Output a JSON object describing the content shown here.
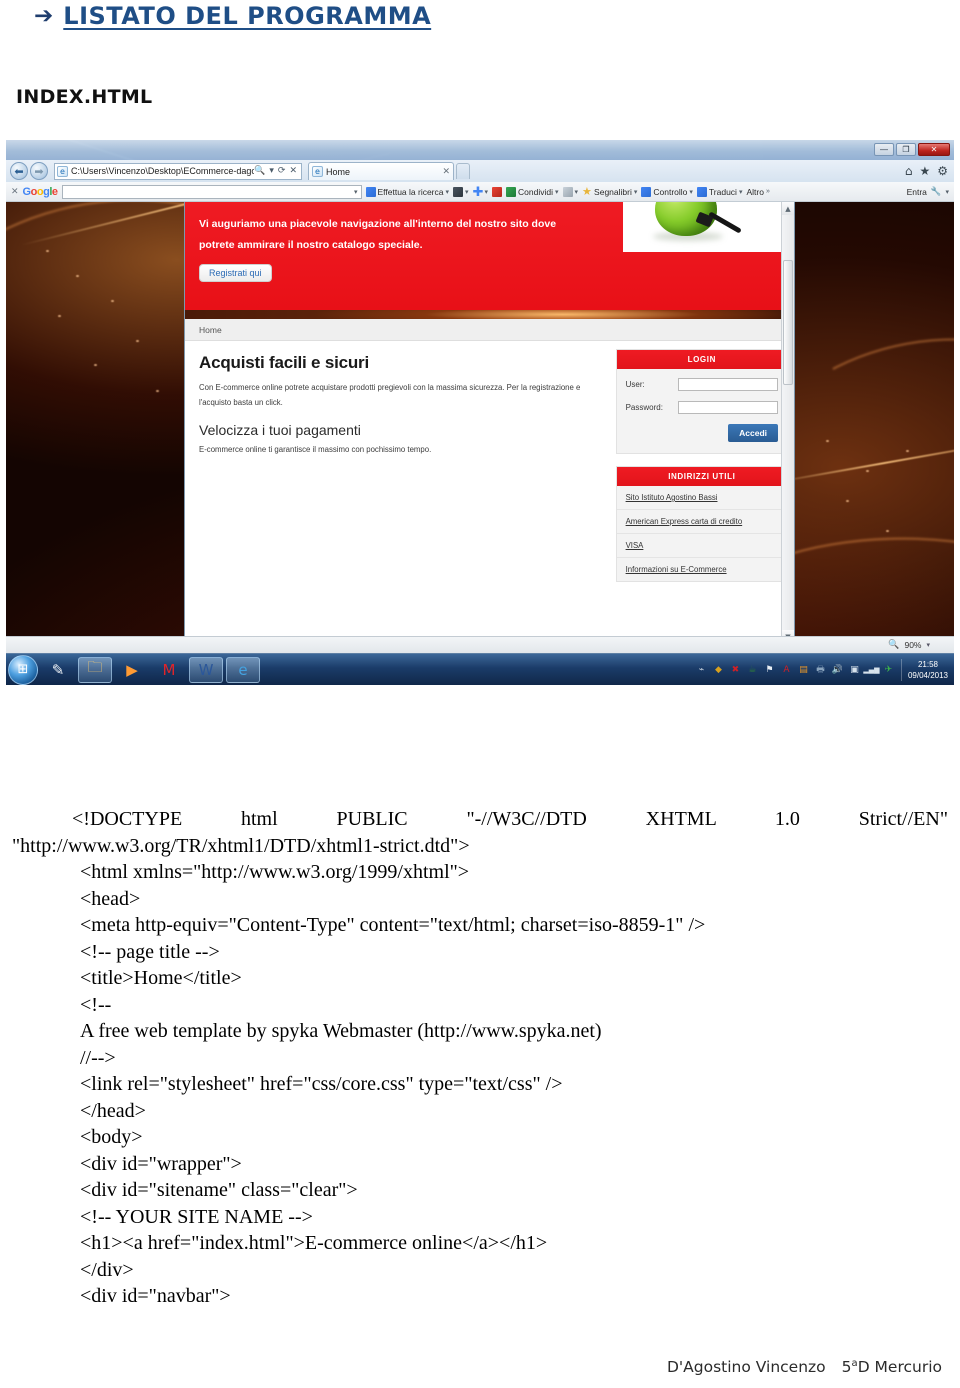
{
  "document": {
    "arrow": "➔",
    "heading": "LISTATO DEL PROGRAMMA",
    "subheading": "INDEX.HTML"
  },
  "screenshot": {
    "browser": {
      "window_controls": {
        "minimize": "—",
        "maximize": "❐",
        "close": "✕"
      },
      "back_arrow": "⬅",
      "forward_arrow": "➡",
      "address": "C:\\Users\\Vincenzo\\Desktop\\ECommerce-dago\\EC(",
      "address_icons": {
        "search": "🔍",
        "dropdown": "▾",
        "refresh": "⟳",
        "stop": "✕"
      },
      "tab_title": "Home",
      "tab_close": "✕",
      "tools": {
        "home": "⌂",
        "favorites": "★",
        "settings": "⚙"
      }
    },
    "google_toolbar": {
      "close": "✕",
      "logo": {
        "g1": "G",
        "o1": "o",
        "o2": "o",
        "g2": "g",
        "l": "l",
        "e": "e"
      },
      "search_placeholder": "",
      "search_caret": "▾",
      "items": [
        {
          "label": "Effettua la ricerca",
          "caret": "▾",
          "icon": "google-search-icon"
        },
        {
          "label": "",
          "caret": "▾",
          "icon": "bookmark-box-icon"
        },
        {
          "label": "",
          "caret": "▾",
          "icon": "plus-icon"
        },
        {
          "label": "",
          "caret": "",
          "icon": "youtube-icon"
        },
        {
          "label": "Condividi",
          "caret": "▾",
          "icon": "share-icon"
        },
        {
          "label": "",
          "caret": "▾",
          "icon": "popup-blocker-icon"
        },
        {
          "label": "Segnalibri",
          "caret": "▾",
          "icon": "star-icon"
        },
        {
          "label": "Controllo",
          "caret": "▾",
          "icon": "spellcheck-icon"
        },
        {
          "label": "Traduci",
          "caret": "▾",
          "icon": "translate-icon"
        },
        {
          "label": "Altro",
          "caret": "»",
          "icon": "more-icon"
        }
      ],
      "signin_label": "Entra",
      "signin_caret": "▾",
      "wrench_icon": "🔧"
    },
    "webpage": {
      "hero": {
        "line1": "Vi auguriamo una piacevole navigazione all'interno del nostro sito dove",
        "line2": "potrete ammirare il nostro catalogo speciale.",
        "button": "Registrati qui",
        "image_alt": "green-apple-with-usb-cable"
      },
      "breadcrumb": "Home",
      "main": {
        "heading1": "Acquisti facili e sicuri",
        "paragraph1": "Con E-commerce online potrete acquistare prodotti pregievoli con la massima sicurezza. Per la registrazione e l'acquisto basta un click.",
        "heading2": "Velocizza i tuoi pagamenti",
        "paragraph2": "E-commerce online ti garantisce il massimo con pochissimo tempo."
      },
      "login_widget": {
        "title": "LOGIN",
        "user_label": "User:",
        "user_value": "",
        "password_label": "Password:",
        "password_value": "",
        "submit_label": "Accedi"
      },
      "links_widget": {
        "title": "INDIRIZZI UTILI",
        "links": [
          "Sito Istituto Agostino Bassi",
          "American Express carta di credito",
          "VISA",
          "Informazioni su E-Commerce"
        ]
      },
      "scrollbar": {
        "up": "▲",
        "down": "▼"
      }
    },
    "status_bar": {
      "zoom_icon": "🔍",
      "zoom_level": "90%",
      "zoom_caret": "▾"
    },
    "taskbar": {
      "start_icon": "⊞",
      "pinned": [
        {
          "name": "paint-icon",
          "glyph": "✎"
        },
        {
          "name": "explorer-folder-icon",
          "glyph": "🗀"
        },
        {
          "name": "media-player-icon",
          "glyph": "▶"
        },
        {
          "name": "mcafee-icon",
          "glyph": "M"
        },
        {
          "name": "word-icon",
          "glyph": "W"
        },
        {
          "name": "internet-explorer-icon",
          "glyph": "e"
        }
      ],
      "tray": [
        {
          "name": "show-hidden-icon",
          "glyph": "⌁",
          "color": "#cfd8e0"
        },
        {
          "name": "security-shield-icon",
          "glyph": "◆",
          "color": "#d8a11e"
        },
        {
          "name": "antivirus-icon",
          "glyph": "✖",
          "color": "#cf2026"
        },
        {
          "name": "java-icon",
          "glyph": "☕",
          "color": "#2f7d3a"
        },
        {
          "name": "flag-action-center-icon",
          "glyph": "⚑",
          "color": "#e8eef4"
        },
        {
          "name": "adobe-reader-icon",
          "glyph": "A",
          "color": "#cf2026"
        },
        {
          "name": "updater-icon",
          "glyph": "▤",
          "color": "#e8972a"
        },
        {
          "name": "printer-icon",
          "glyph": "🖶",
          "color": "#8aa4bd"
        },
        {
          "name": "volume-icon",
          "glyph": "🔊",
          "color": "#e8eef4"
        },
        {
          "name": "device-icon",
          "glyph": "▣",
          "color": "#d7e2ec"
        },
        {
          "name": "network-signal-icon",
          "glyph": "▂▄▆",
          "color": "#d7e2ec"
        },
        {
          "name": "messenger-icon",
          "glyph": "✈",
          "color": "#3cb44a"
        }
      ],
      "time": "21:58",
      "date": "09/04/2013"
    }
  },
  "code": {
    "line1": "<!DOCTYPE html PUBLIC \"-//W3C//DTD XHTML 1.0 Strict//EN\"",
    "line2": "\"http://www.w3.org/TR/xhtml1/DTD/xhtml1-strict.dtd\">",
    "line3": "<html xmlns=\"http://www.w3.org/1999/xhtml\">",
    "line4": "<head>",
    "line5": "<meta http-equiv=\"Content-Type\" content=\"text/html; charset=iso-8859-1\" />",
    "line6": "<!-- page title -->",
    "line7": "<title>Home</title>",
    "line8": "<!--",
    "line9": "A free web template by spyka Webmaster (http://www.spyka.net)",
    "line10": "//-->",
    "line11": "<link rel=\"stylesheet\" href=\"css/core.css\" type=\"text/css\" />",
    "line12": "</head>",
    "line13": "<body>",
    "line14": "<div id=\"wrapper\">",
    "line15": "<div id=\"sitename\" class=\"clear\">",
    "line16": "<!-- YOUR SITE NAME -->",
    "line17": "<h1><a href=\"index.html\">E-commerce online</a></h1>",
    "line18": "</div>",
    "line19": "<div id=\"navbar\">"
  },
  "footer": {
    "author": "D'Agostino Vincenzo",
    "class_number": "5",
    "class_sup": "a",
    "class_rest": "D Mercurio"
  }
}
